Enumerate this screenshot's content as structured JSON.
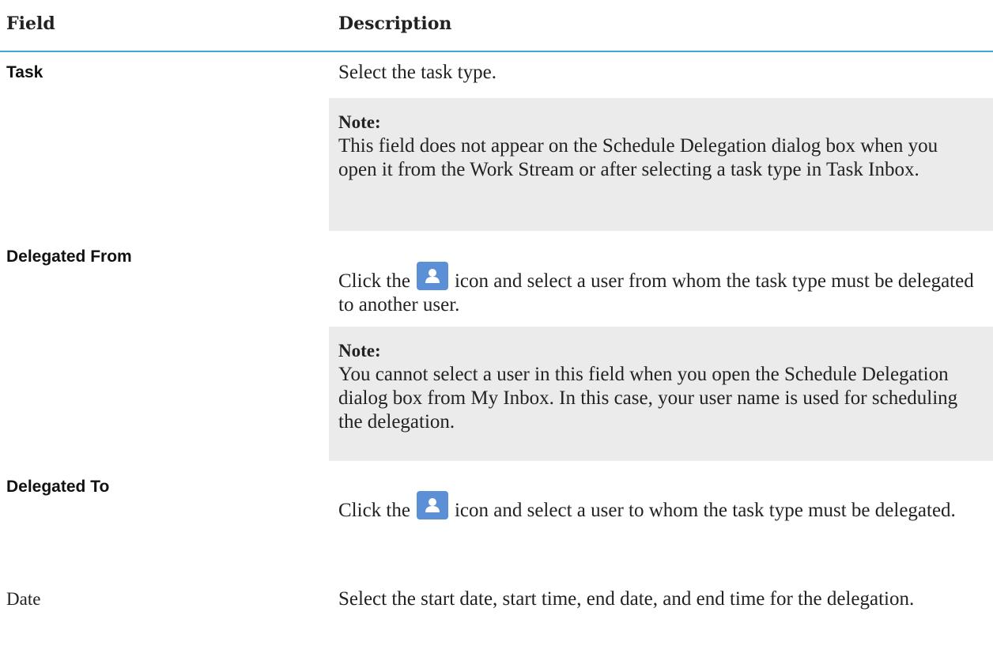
{
  "table": {
    "headers": {
      "field": "Field",
      "description": "Description"
    },
    "rows": [
      {
        "field": "Task",
        "description": "Select the task type.",
        "note": {
          "title": "Note:",
          "text": "This field does not appear on the Schedule Delegation dialog box when you open it from the Work Stream or after selecting a task type in Task Inbox."
        }
      },
      {
        "field": "Delegated From",
        "description_before_icon": "Click the",
        "icon": "user-icon",
        "description_after_icon": "icon and select a user from whom the task type must be delegated to another user.",
        "note": {
          "title": "Note:",
          "text": "You cannot select a user in this field when you open the Schedule Delegation dialog box from My Inbox. In this case, your user name is used for scheduling the delegation."
        }
      },
      {
        "field": "Delegated To",
        "description_before_icon": "Click the",
        "icon": "user-icon",
        "description_after_icon": "icon and select a user to whom the task type must be delegated."
      },
      {
        "field": "Date",
        "description": "Select the start date, start time, end date, and end time for the delegation."
      }
    ]
  },
  "colors": {
    "header_rule": "#3fa7d8",
    "note_background": "#ebebeb",
    "icon_background": "#5b8fd6"
  }
}
